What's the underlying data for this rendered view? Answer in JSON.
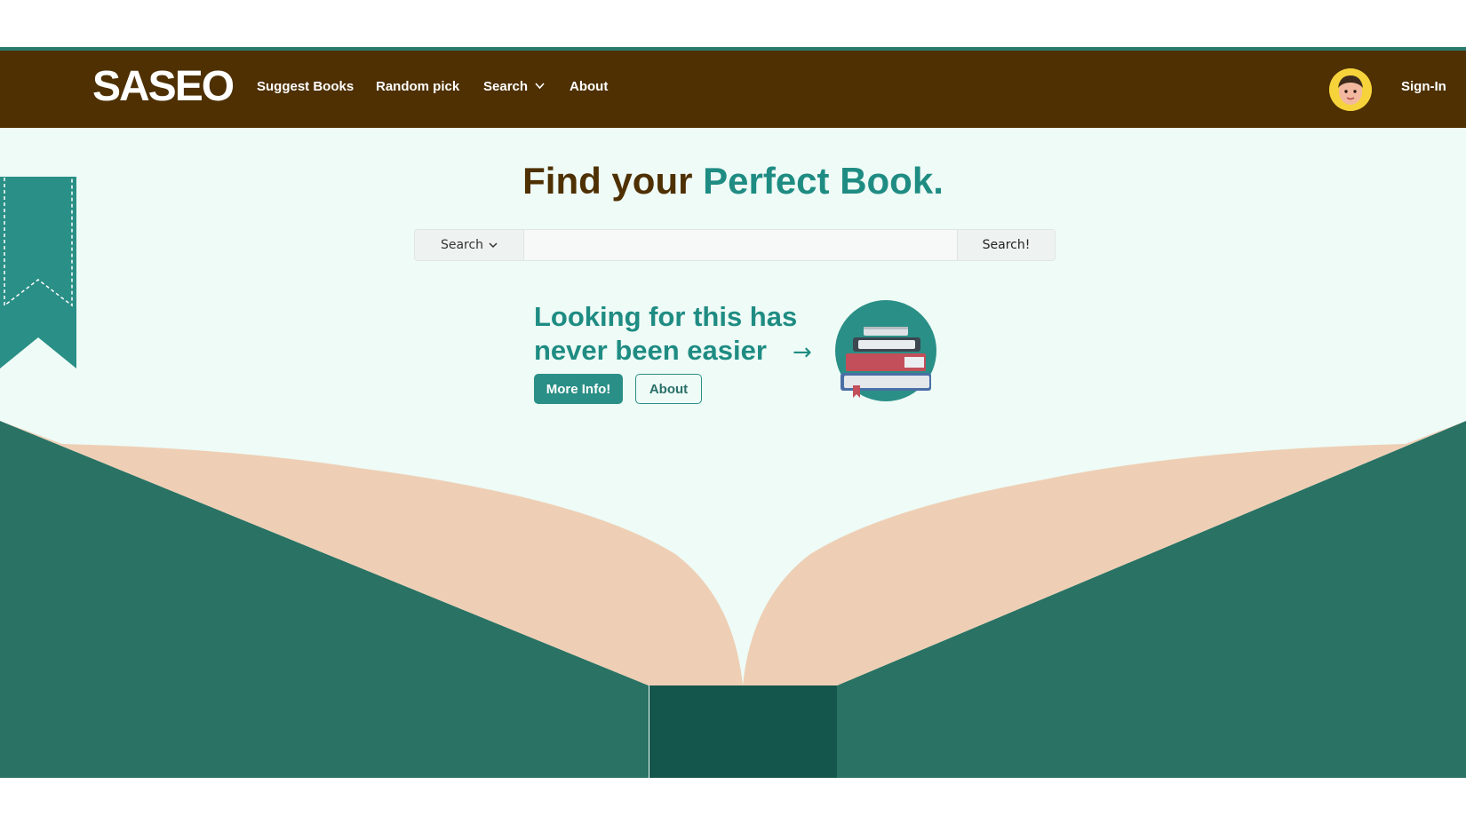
{
  "brand": {
    "logo": "SASEO"
  },
  "nav": {
    "suggest_books": "Suggest Books",
    "random_pick": "Random pick",
    "search": "Search",
    "about": "About",
    "sign_in": "Sign-In"
  },
  "hero": {
    "title_part1": "Find your",
    "title_part2": "Perfect Book."
  },
  "searchbar": {
    "select_value": "Search",
    "input_value": "",
    "button_label": "Search!"
  },
  "promo": {
    "line1": "Looking for this has",
    "line2": "never been easier",
    "arrow": "→",
    "more_info": "More Info!",
    "about": "About"
  },
  "icons": {
    "nav_search_dropdown": "chevron-down-icon",
    "search_select_dropdown": "chevron-down-icon",
    "avatar": "user-avatar",
    "books": "book-stack-illustration",
    "bookmark": "bookmark-ribbon"
  },
  "colors": {
    "navbar_bg": "#4e3003",
    "teal_accent": "#1f8c83",
    "page_bg": "#eefbf6",
    "book_cover": "#297264",
    "book_pages": "#eecfb5"
  }
}
